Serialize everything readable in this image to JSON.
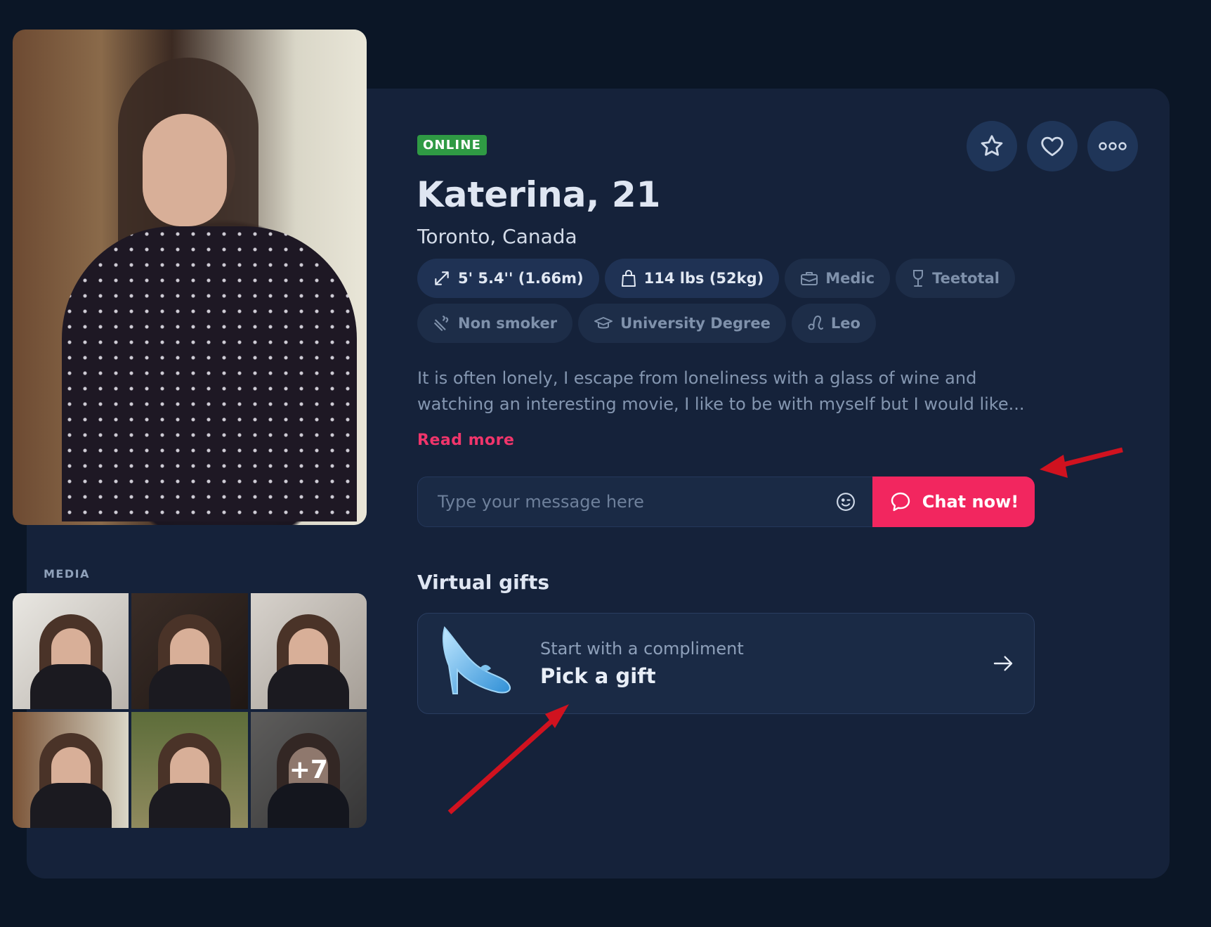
{
  "profile": {
    "status_badge": "ONLINE",
    "name_age": "Katerina, 21",
    "location": "Toronto, Canada",
    "chips_row1": [
      {
        "label": "5' 5.4'' (1.66m)",
        "icon": "resize-arrow-icon"
      },
      {
        "label": "114 lbs (52kg)",
        "icon": "weight-bag-icon"
      },
      {
        "label": "Medic",
        "icon": "briefcase-icon"
      },
      {
        "label": "Teetotal",
        "icon": "wine-glass-icon"
      }
    ],
    "chips_row2": [
      {
        "label": "Non smoker",
        "icon": "cigarette-icon"
      },
      {
        "label": "University Degree",
        "icon": "graduation-cap-icon"
      },
      {
        "label": "Leo",
        "icon": "leo-zodiac-icon"
      }
    ],
    "bio": "It is often lonely, I escape from loneliness with a glass of wine and watching an interesting movie, I like to be with myself but I would like...",
    "read_more": "Read more"
  },
  "actions": {
    "favorite_icon": "star-icon",
    "like_icon": "heart-icon",
    "more_icon": "more-options-icon"
  },
  "message": {
    "placeholder": "Type your message here",
    "emoji_icon": "emoji-wink-icon",
    "chat_button": "Chat now!"
  },
  "gifts": {
    "title": "Virtual gifts",
    "subtitle": "Start with a compliment",
    "cta": "Pick a gift",
    "image": "glass-slipper"
  },
  "media": {
    "label": "MEDIA",
    "more_count": "+7"
  },
  "colors": {
    "background": "#0b1626",
    "card": "#15223a",
    "accent": "#f2265f",
    "online": "#2f9a44",
    "annotation_arrow": "#d0121f"
  }
}
